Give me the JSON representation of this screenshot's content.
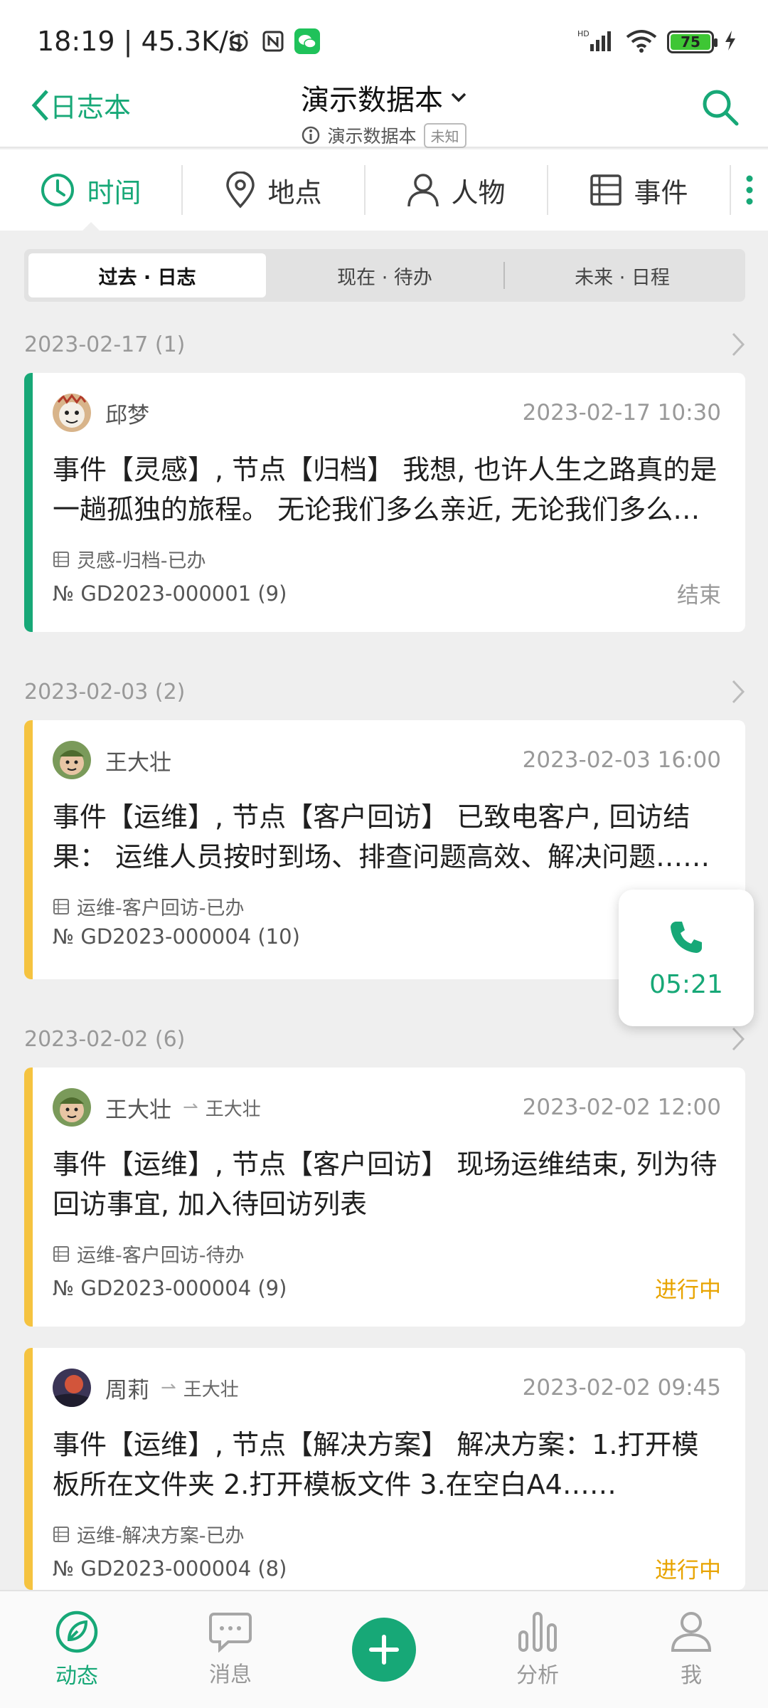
{
  "status_bar": {
    "time": "18:19 | 45.3K/s",
    "battery": "75",
    "network": "HD"
  },
  "header": {
    "back_label": "日志本",
    "title": "演示数据本",
    "subtitle": "演示数据本",
    "badge": "未知"
  },
  "tabs": [
    {
      "label": "时间",
      "icon": "clock-icon",
      "active": true
    },
    {
      "label": "地点",
      "icon": "location-pin-icon"
    },
    {
      "label": "人物",
      "icon": "person-icon"
    },
    {
      "label": "事件",
      "icon": "list-icon"
    }
  ],
  "segments": [
    "过去 · 日志",
    "现在 · 待办",
    "未来 · 日程"
  ],
  "groups": [
    {
      "date": "2023-02-17 (1)",
      "items": [
        {
          "author": "邱梦",
          "time": "2023-02-17 10:30",
          "content": " 事件【灵感】, 节点【归档】 我想, 也许人生之路真的是一趟孤独的旅程。 无论我们多么亲近, 无论我们多么相爱……",
          "meta": "灵感-归档-已办",
          "no": "№ GD2023-000001 (9)",
          "status": "结束",
          "bar_color": "#17a877",
          "status_color": "#999999"
        }
      ]
    },
    {
      "date": "2023-02-03 (2)",
      "items": [
        {
          "author": "王大壮",
          "time": "2023-02-03 16:00",
          "content": "事件【运维】, 节点【客户回访】 已致电客户, 回访结果： 运维人员按时到场、排查问题高效、解决问题……",
          "meta": "运维-客户回访-已办",
          "no": "№ GD2023-000004 (10)",
          "status": "",
          "bar_color": "#f5c340"
        }
      ]
    },
    {
      "date": "2023-02-02 (6)",
      "items": [
        {
          "author": "王大壮",
          "target": "王大壮",
          "time": "2023-02-02 12:00",
          "content": "事件【运维】, 节点【客户回访】 现场运维结束, 列为待回访事宜, 加入待回访列表",
          "meta": "运维-客户回访-待办",
          "no": "№ GD2023-000004 (9)",
          "status": "进行中",
          "bar_color": "#f5c340",
          "status_color": "#e8a400"
        },
        {
          "author": "周莉",
          "target": "王大壮",
          "time": "2023-02-02 09:45",
          "content": "事件【运维】, 节点【解决方案】 解决方案：1.打开模板所在文件夹 2.打开模板文件 3.在空白A4……",
          "meta": "运维-解决方案-已办",
          "no": "№ GD2023-000004 (8)",
          "status": "进行中",
          "bar_color": "#f5c340",
          "status_color": "#e8a400"
        }
      ]
    }
  ],
  "call": {
    "timer": "05:21"
  },
  "bottom_nav": [
    {
      "label": "动态",
      "active": true
    },
    {
      "label": "消息"
    },
    {
      "label": ""
    },
    {
      "label": "分析"
    },
    {
      "label": "我"
    }
  ]
}
